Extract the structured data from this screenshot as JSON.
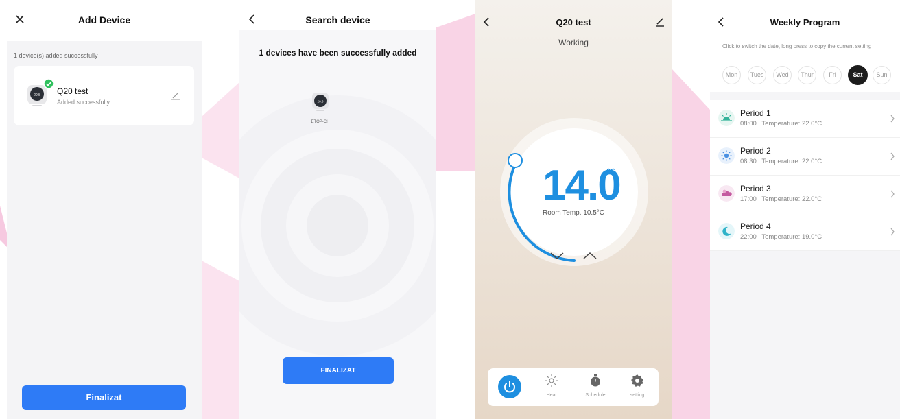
{
  "screens": {
    "add_device": {
      "title": "Add Device",
      "success_note": "1 device(s) added successfully",
      "device": {
        "name": "Q20 test",
        "status": "Added successfully",
        "thumb_temp": "20.5"
      },
      "finish_button": "Finalizat",
      "icons": {
        "close": "close-icon",
        "check": "check-badge-icon",
        "edit": "pencil-icon"
      }
    },
    "search_device": {
      "title": "Search device",
      "added_message": "1 devices have been successfully added",
      "device": {
        "label": "ETOP-CH",
        "thumb_temp": "20.5"
      },
      "finish_button": "FINALIZAT",
      "icons": {
        "back": "chevron-left-icon"
      }
    },
    "thermostat": {
      "title": "Q20 test",
      "status": "Working",
      "set_temp": "14.0",
      "unit": "℃",
      "room_temp": "Room Temp. 10.5°C",
      "tabs": [
        {
          "label": "",
          "icon": "power-icon",
          "active": true
        },
        {
          "label": "Heat",
          "icon": "sun-icon"
        },
        {
          "label": "Schedule",
          "icon": "stopwatch-icon"
        },
        {
          "label": "setting",
          "icon": "gear-icon"
        }
      ],
      "icons": {
        "back": "chevron-left-icon",
        "edit": "pencil-icon",
        "down": "chevron-down-icon",
        "up": "chevron-up-icon"
      },
      "accent": "#1e8fe0"
    },
    "weekly_program": {
      "title": "Weekly Program",
      "hint": "Click to switch the date, long press to copy the current setting",
      "days": [
        {
          "label": "Mon"
        },
        {
          "label": "Tues"
        },
        {
          "label": "Wed"
        },
        {
          "label": "Thur"
        },
        {
          "label": "Fri"
        },
        {
          "label": "Sat",
          "active": true
        },
        {
          "label": "Sun"
        }
      ],
      "periods": [
        {
          "name": "Period 1",
          "detail": "08:00 | Temperature: 22.0°C",
          "icon": "sunrise-icon",
          "color": "#34b39a"
        },
        {
          "name": "Period 2",
          "detail": "08:30 | Temperature: 22.0°C",
          "icon": "sun-icon",
          "color": "#4a90e2"
        },
        {
          "name": "Period 3",
          "detail": "17:00 | Temperature: 22.0°C",
          "icon": "sunset-cloud-icon",
          "color": "#c45aa0"
        },
        {
          "name": "Period 4",
          "detail": "22:00 | Temperature: 19.0°C",
          "icon": "moon-icon",
          "color": "#2fb3c9"
        }
      ],
      "icons": {
        "back": "chevron-left-icon",
        "chevron": "chevron-right-icon"
      }
    }
  },
  "colors": {
    "primary_button": "#2e7bf6",
    "background_decor": "#f6d9ea"
  }
}
